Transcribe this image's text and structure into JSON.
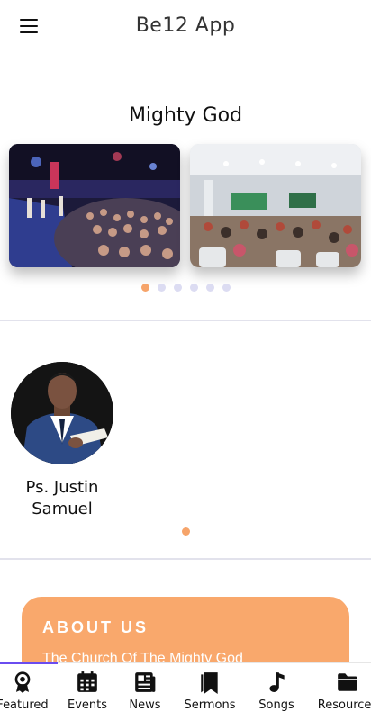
{
  "app": {
    "title": "Be12 App"
  },
  "hero": {
    "title": "Mighty God",
    "slides": [
      {
        "icon": "worship-stage-photo"
      },
      {
        "icon": "church-hall-photo"
      }
    ],
    "pagination": {
      "count": 6,
      "active_index": 0
    }
  },
  "pastor": {
    "name_line1": "Ps. Justin",
    "name_line2": "Samuel"
  },
  "pastor_pagination": {
    "count": 1,
    "active_index": 0
  },
  "about": {
    "title": "ABOUT US",
    "text": "The Church Of The Mighty God"
  },
  "bottom_nav": {
    "items": [
      {
        "label": "Featured",
        "icon": "award-icon"
      },
      {
        "label": "Events",
        "icon": "calendar-icon"
      },
      {
        "label": "News",
        "icon": "newspaper-icon"
      },
      {
        "label": "Sermons",
        "icon": "bookmark-icon"
      },
      {
        "label": "Songs",
        "icon": "music-note-icon"
      },
      {
        "label": "Resources",
        "icon": "folder-icon"
      }
    ],
    "active_index": 0
  },
  "colors": {
    "accent": "#f6a46a",
    "about_bg": "#f9a86c",
    "dot_inactive": "#dcdcf2",
    "indicator": "#6a4cf0"
  }
}
